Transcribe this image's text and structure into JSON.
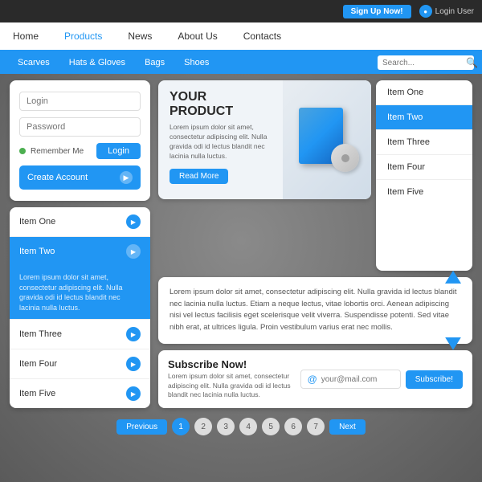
{
  "topbar": {
    "signup_label": "Sign Up Now!",
    "login_label": "Login User"
  },
  "nav": {
    "items": [
      {
        "label": "Home"
      },
      {
        "label": "Products",
        "active": true
      },
      {
        "label": "News"
      },
      {
        "label": "About Us"
      },
      {
        "label": "Contacts"
      }
    ]
  },
  "subnav": {
    "items": [
      {
        "label": "Scarves"
      },
      {
        "label": "Hats & Gloves"
      },
      {
        "label": "Bags"
      },
      {
        "label": "Shoes"
      }
    ],
    "search_placeholder": "Search..."
  },
  "login": {
    "username_placeholder": "Login",
    "password_placeholder": "Password",
    "remember_label": "Remember Me",
    "login_btn": "Login",
    "create_btn": "Create Account"
  },
  "accordion": {
    "items": [
      {
        "label": "Item One",
        "active": false
      },
      {
        "label": "Item Two",
        "active": true
      },
      {
        "label": "Item Three",
        "active": false
      },
      {
        "label": "Item Four",
        "active": false
      },
      {
        "label": "Item Five",
        "active": false
      }
    ],
    "active_body": "Lorem ipsum dolor sit amet, consectetur adipiscing elit. Nulla gravida odi id lectus blandit nec lacinia nulla luctus."
  },
  "product": {
    "title": "YOUR PRODUCT",
    "description": "Lorem ipsum dolor sit amet, consectetur adipiscing elit. Nulla gravida odi id lectus blandit nec lacinia nulla luctus.",
    "read_more": "Read More"
  },
  "item_list": {
    "items": [
      {
        "label": "Item One"
      },
      {
        "label": "Item Two",
        "active": true
      },
      {
        "label": "Item Three"
      },
      {
        "label": "Item Four"
      },
      {
        "label": "Item Five"
      }
    ]
  },
  "text_content": "Lorem ipsum dolor sit amet, consectetur adipiscing elit. Nulla gravida id lectus blandit nec lacinia nulla luctus. Etiam a neque lectus, vitae lobortis orci. Aenean adipiscing nisi vel lectus facilisis eget scelerisque velit viverra. Suspendisse potenti. Sed vitae nibh erat, at ultrices ligula. Proin vestibulum varius erat nec mollis.",
  "subscribe": {
    "title": "Subscribe Now!",
    "description": "Lorem ipsum dolor sit amet, consectetur adipiscing elit. Nulla gravida odi id lectus blandit nec lacinia nulla luctus.",
    "email_placeholder": "your@mail.com",
    "subscribe_btn": "Subscribe!"
  },
  "pagination": {
    "prev_label": "Previous",
    "next_label": "Next",
    "pages": [
      "1",
      "2",
      "3",
      "4",
      "5",
      "6",
      "7"
    ],
    "active_page": "1"
  }
}
